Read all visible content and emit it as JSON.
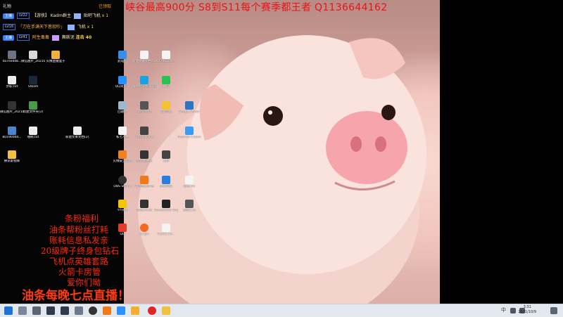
{
  "headline": "峡谷最高900分 S8到S11每个赛季都王者  Q1136644162",
  "chat": {
    "header_title": "礼物",
    "header_right": "已领取",
    "rows": [
      {
        "badge": "主播",
        "level": "LV22",
        "text": "【游侠】 Kadm群主",
        "gift": "贴吧飞机",
        "count": "x 1"
      },
      {
        "badge": "",
        "level": "LV18",
        "text": "「刀在手满天下皆寂吵」",
        "gift": "飞机",
        "count": "x 1"
      },
      {
        "badge": "主播",
        "level": "LV41",
        "text": "阿生毒毒",
        "gift": "舞斯泥",
        "count": "连击 40"
      }
    ]
  },
  "left_icons": [
    {
      "label": "4a7eed4b..."
    },
    {
      "label": "微信图片_2021073..."
    },
    {
      "label": "头像直播盒子"
    },
    {
      "label": "步职.txt"
    },
    {
      "label": "Steam"
    },
    {
      "label": "微信图片_2021070..."
    },
    {
      "label": "新建文件夹(2)"
    },
    {
      "label": "80190dd4..."
    },
    {
      "label": "哦啊.txt"
    },
    {
      "label": "新建文本文档(2).txt"
    },
    {
      "label": "腾讯影视库"
    }
  ],
  "desktop_icons": [
    {
      "label": "此电脑"
    },
    {
      "label": "新建文本文档.txt"
    },
    {
      "label": "6f7901e4..."
    },
    {
      "label": "QQ浏览器"
    },
    {
      "label": "海豚网游加速器5.0"
    },
    {
      "label": "微信"
    },
    {
      "label": "回收站"
    },
    {
      "label": "WeGame"
    },
    {
      "label": "QQ音乐"
    },
    {
      "label": "Snagit Editor"
    },
    {
      "label": "私七八楼"
    },
    {
      "label": "Studio One"
    },
    {
      "label": "Internet Explorer"
    },
    {
      "label": "火绒安全软件"
    },
    {
      "label": "新建文件夹"
    },
    {
      "label": "录屏"
    },
    {
      "label": "OBS Studio"
    },
    {
      "label": "斗鱼直播伴侣"
    },
    {
      "label": "企鹅电竞"
    },
    {
      "label": "新建.txt"
    },
    {
      "label": "YY开播"
    },
    {
      "label": "新建文件夹"
    },
    {
      "label": "Steelseries Engine"
    },
    {
      "label": "截图工具"
    },
    {
      "label": "QQ"
    },
    {
      "label": "Origin"
    },
    {
      "label": "FA201-10..."
    }
  ],
  "promo_lines": [
    "条粉福利",
    "油条帮粉丝打耗",
    "账耗信息私发亲",
    "20级牌子终身包钻石",
    "飞机点英雄套路",
    "火箭卡房管",
    "爱你们呦"
  ],
  "promo_big": "油条每晚七点直播！",
  "taskbar": {
    "time": "3:31",
    "date": "2021/10/9",
    "lang": "中"
  },
  "colors": {
    "headline": "#e81515",
    "promo": "#ff2a0a",
    "taskbar": "#e3e7ee"
  }
}
